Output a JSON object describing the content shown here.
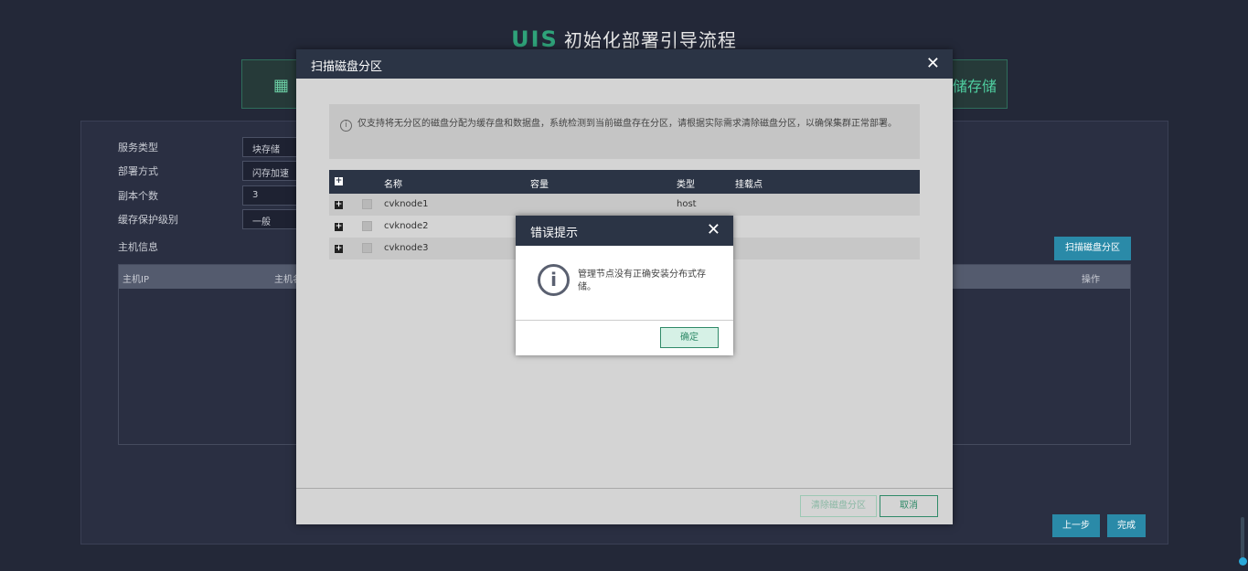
{
  "app": {
    "logo": "UIS",
    "title": "初始化部署引导流程"
  },
  "steps": {
    "right_label": "储存储"
  },
  "form": {
    "service_type": {
      "label": "服务类型",
      "value": "块存储"
    },
    "deploy_mode": {
      "label": "部署方式",
      "value": "闪存加速"
    },
    "replica_count": {
      "label": "副本个数",
      "value": "3"
    },
    "cache_protect": {
      "label": "缓存保护级别",
      "value": "一般"
    }
  },
  "host_section": {
    "title": "主机信息",
    "col_ip": "主机IP",
    "col_name": "主机名",
    "col_action": "操作",
    "scan_button": "扫描磁盘分区"
  },
  "wizard": {
    "prev_button": "上一步",
    "done_button": "完成"
  },
  "scan_dialog": {
    "title": "扫描磁盘分区",
    "info_text": "仅支持将无分区的磁盘分配为缓存盘和数据盘，系统检测到当前磁盘存在分区，请根据实际需求清除磁盘分区，以确保集群正常部署。",
    "columns": [
      "名称",
      "容量",
      "类型",
      "挂载点"
    ],
    "rows": [
      {
        "name": "cvknode1",
        "capacity": "",
        "type": "host",
        "mount": ""
      },
      {
        "name": "cvknode2",
        "capacity": "",
        "type": "",
        "mount": ""
      },
      {
        "name": "cvknode3",
        "capacity": "",
        "type": "",
        "mount": ""
      }
    ],
    "clear_button": "清除磁盘分区",
    "cancel_button": "取消"
  },
  "error_dialog": {
    "title": "错误提示",
    "message": "管理节点没有正确安装分布式存储。",
    "ok_button": "确定"
  },
  "colors": {
    "accent": "#2a8aa8",
    "brand_green": "#2fa37a",
    "header_dark": "#2b3445"
  }
}
